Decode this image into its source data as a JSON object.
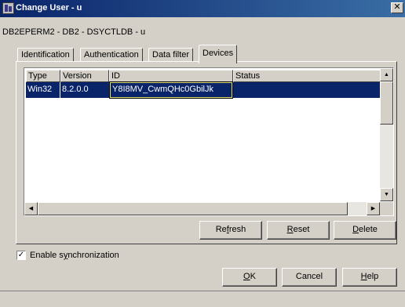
{
  "window": {
    "title": "Change User - u",
    "close_symbol": "✕"
  },
  "subtitle": "DB2EPERM2 - DB2 - DSYCTLDB - u",
  "tabs": [
    {
      "label": "Identification",
      "active": false
    },
    {
      "label": "Authentication",
      "active": false
    },
    {
      "label": "Data filter",
      "active": false
    },
    {
      "label": "Devices",
      "active": true
    }
  ],
  "table": {
    "columns": [
      "Type",
      "Version",
      "ID",
      "Status"
    ],
    "rows": [
      {
        "type": "Win32",
        "version": "8.2.0.0",
        "id": "Y8I8MV_CwmQHc0GbilJk",
        "status": "",
        "selected": true
      }
    ]
  },
  "scroll": {
    "up": "▲",
    "down": "▼",
    "left": "◀",
    "right": "▶"
  },
  "buttons": {
    "refresh": {
      "pre": "Re",
      "accel": "f",
      "post": "resh"
    },
    "reset": {
      "pre": "",
      "accel": "R",
      "post": "eset"
    },
    "delete": {
      "pre": "",
      "accel": "D",
      "post": "elete"
    },
    "ok": {
      "pre": "",
      "accel": "O",
      "post": "K"
    },
    "cancel": "Cancel",
    "help": {
      "pre": "",
      "accel": "H",
      "post": "elp"
    }
  },
  "sync": {
    "checked": true,
    "check_mark": "✓",
    "label_pre": "Enable s",
    "label_accel": "y",
    "label_post": "nchronization"
  },
  "colors": {
    "titlebar": "#0a246a",
    "selection": "#0a246a",
    "face": "#d4d0c8"
  }
}
